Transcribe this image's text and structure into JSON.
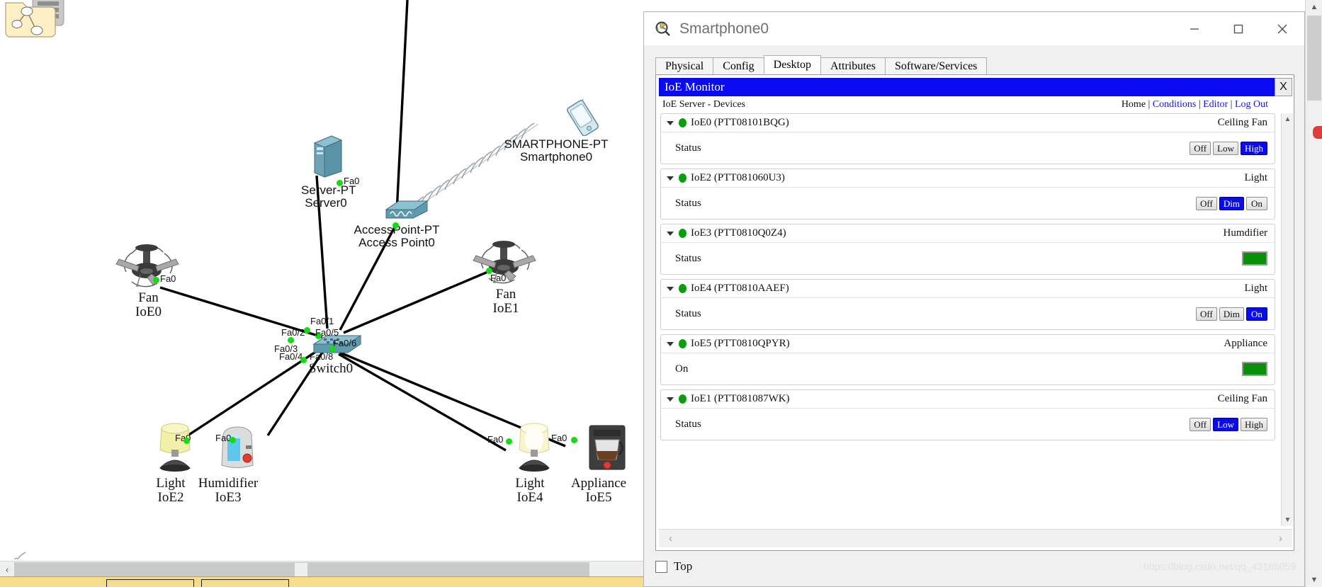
{
  "window": {
    "title": "Smartphone0",
    "app_icon": "smartphone-magnifier-icon",
    "minimize_label": "—",
    "maximize_label": "☐",
    "close_label": "✕"
  },
  "tabs": [
    {
      "label": "Physical",
      "active": false
    },
    {
      "label": "Config",
      "active": false
    },
    {
      "label": "Desktop",
      "active": true
    },
    {
      "label": "Attributes",
      "active": false
    },
    {
      "label": "Software/Services",
      "active": false
    }
  ],
  "ioe": {
    "title": "IoE Monitor",
    "close_label": "X",
    "breadcrumb": "IoE Server - Devices",
    "nav": {
      "home": "Home",
      "conditions": "Conditions",
      "editor": "Editor",
      "logout": "Log Out",
      "separator": "|"
    },
    "devices": [
      {
        "name": "IoE0 (PTT08101BQG)",
        "type": "Ceiling Fan",
        "status_label": "Status",
        "control": "buttons",
        "buttons": [
          "Off",
          "Low",
          "High"
        ],
        "selected": "High"
      },
      {
        "name": "IoE2 (PTT081060U3)",
        "type": "Light",
        "status_label": "Status",
        "control": "buttons",
        "buttons": [
          "Off",
          "Dim",
          "On"
        ],
        "selected": "Dim"
      },
      {
        "name": "IoE3 (PTT0810Q0Z4)",
        "type": "Humdifier",
        "status_label": "Status",
        "control": "swatch",
        "swatch_color": "#089008"
      },
      {
        "name": "IoE4 (PTT0810AAEF)",
        "type": "Light",
        "status_label": "Status",
        "control": "buttons",
        "buttons": [
          "Off",
          "Dim",
          "On"
        ],
        "selected": "On"
      },
      {
        "name": "IoE5 (PTT0810QPYR)",
        "type": "Appliance",
        "status_label": "On",
        "control": "swatch",
        "swatch_color": "#089008"
      },
      {
        "name": "IoE1 (PTT081087WK)",
        "type": "Ceiling Fan",
        "status_label": "Status",
        "control": "buttons",
        "buttons": [
          "Off",
          "Low",
          "High"
        ],
        "selected": "Low"
      }
    ]
  },
  "footer": {
    "top_checkbox_label": "Top",
    "top_checked": false,
    "watermark": "https://blog.csdn.net/qq_43185059"
  },
  "scroll": {
    "left_arrow": "‹",
    "right_arrow": "›",
    "up_arrow": "▲",
    "down_arrow": "▼"
  },
  "topology": {
    "nodes": [
      {
        "id": "server0",
        "model": "Server-PT",
        "name": "Server0",
        "port": "Fa0"
      },
      {
        "id": "ap0",
        "model": "AccessPoint-PT",
        "name": "Access Point0",
        "port": ""
      },
      {
        "id": "phone0",
        "model": "SMARTPHONE-PT",
        "name": "Smartphone0",
        "port": ""
      },
      {
        "id": "fan_ioe0",
        "model": "Fan",
        "name": "IoE0",
        "port": "Fa0"
      },
      {
        "id": "fan_ioe1",
        "model": "Fan",
        "name": "IoE1",
        "port": "Fa0"
      },
      {
        "id": "switch0",
        "model": "",
        "name": "Switch0",
        "port": ""
      },
      {
        "id": "light_ioe2",
        "model": "Light",
        "name": "IoE2",
        "port": "Fa0"
      },
      {
        "id": "humid_ioe3",
        "model": "Humidifier",
        "name": "IoE3",
        "port": "Fa0"
      },
      {
        "id": "light_ioe4",
        "model": "Light",
        "name": "IoE4",
        "port": "Fa0"
      },
      {
        "id": "appl_ioe5",
        "model": "Appliance",
        "name": "IoE5",
        "port": "Fa0"
      }
    ],
    "switch_ports": [
      "Fa0/1",
      "Fa0/2",
      "Fa0/5",
      "Fa0/6",
      "Fa0/3",
      "Fa0/4",
      "Fa0/8"
    ]
  }
}
